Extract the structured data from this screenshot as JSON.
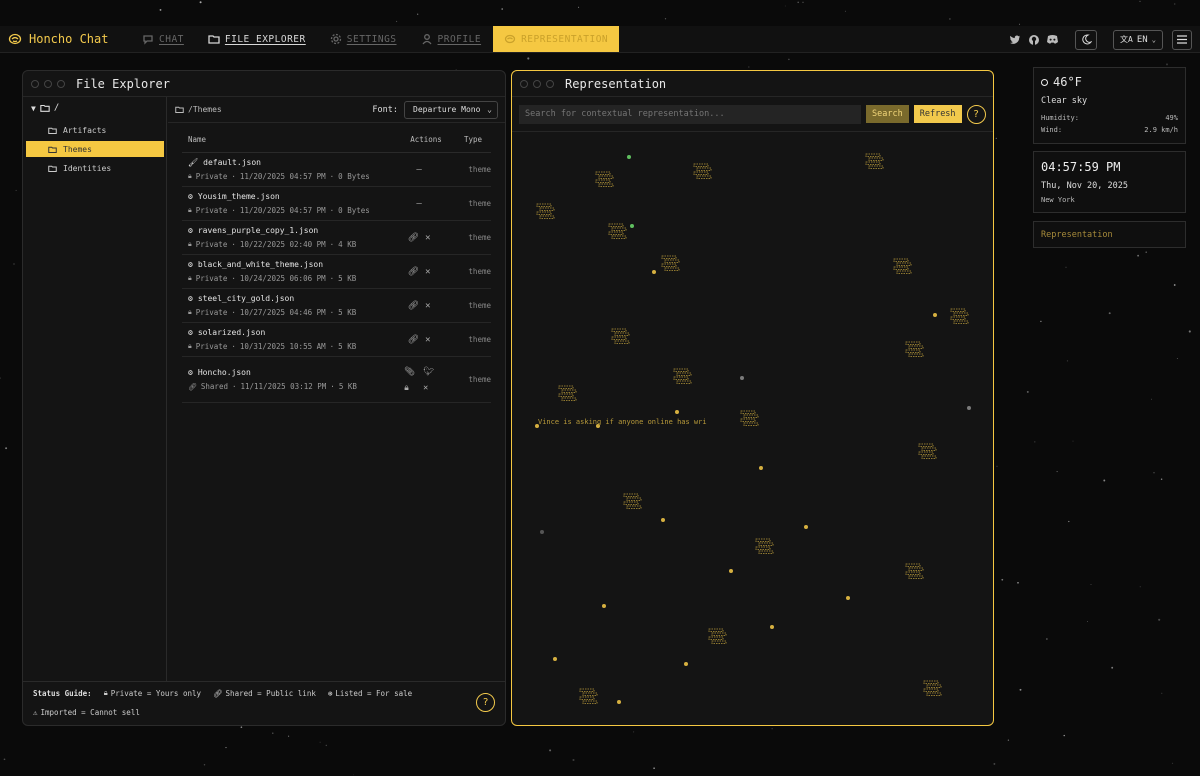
{
  "brand": {
    "name": "Honcho Chat"
  },
  "nav": [
    {
      "label": "CHAT",
      "icon": "chat-bubble-icon"
    },
    {
      "label": "FILE EXPLORER",
      "icon": "folder-icon"
    },
    {
      "label": "SETTINGS",
      "icon": "gear-icon"
    },
    {
      "label": "PROFILE",
      "icon": "user-icon"
    },
    {
      "label": "REPRESENTATION",
      "icon": "brain-icon"
    }
  ],
  "topbar": {
    "language": "EN",
    "accent": "#f5c842"
  },
  "file_explorer": {
    "title": "File Explorer",
    "tree_root": "/",
    "tree": [
      {
        "label": "Artifacts"
      },
      {
        "label": "Themes"
      },
      {
        "label": "Identities"
      }
    ],
    "path": "/Themes",
    "font_label": "Font:",
    "font_value": "Departure Mono",
    "columns": {
      "name": "Name",
      "actions": "Actions",
      "type": "Type"
    },
    "files": [
      {
        "name": "default.json",
        "visibility": "Private",
        "date": "11/20/2025 04:57 PM",
        "size": "0 Bytes",
        "type": "theme",
        "actions": "—"
      },
      {
        "name": "Yousim_theme.json",
        "visibility": "Private",
        "date": "11/20/2025 04:57 PM",
        "size": "0 Bytes",
        "type": "theme",
        "actions": "—"
      },
      {
        "name": "ravens_purple_copy_1.json",
        "visibility": "Private",
        "date": "10/22/2025 02:40 PM",
        "size": "4 KB",
        "type": "theme",
        "actions": "link"
      },
      {
        "name": "black_and_white_theme.json",
        "visibility": "Private",
        "date": "10/24/2025 06:06 PM",
        "size": "5 KB",
        "type": "theme",
        "actions": "link"
      },
      {
        "name": "steel_city_gold.json",
        "visibility": "Private",
        "date": "10/27/2025 04:46 PM",
        "size": "5 KB",
        "type": "theme",
        "actions": "link"
      },
      {
        "name": "solarized.json",
        "visibility": "Private",
        "date": "10/31/2025 10:55 AM",
        "size": "5 KB",
        "type": "theme",
        "actions": "link"
      },
      {
        "name": "Honcho.json",
        "visibility": "Shared",
        "date": "11/11/2025 03:12 PM",
        "size": "5 KB",
        "type": "theme",
        "actions": "shared"
      }
    ],
    "status_guide": {
      "label": "Status Guide:",
      "private": "Private = Yours only",
      "shared": "Shared = Public link",
      "listed": "Listed = For sale",
      "imported": "Imported = Cannot sell"
    }
  },
  "representation": {
    "title": "Representation",
    "search_placeholder": "Search for contextual representation...",
    "search_label": "Search",
    "refresh_label": "Refresh",
    "message": "Vince is asking if anyone online has wri"
  },
  "weather": {
    "temp": "46°F",
    "sky": "Clear sky",
    "humidity_label": "Humidity:",
    "humidity": "49%",
    "wind_label": "Wind:",
    "wind": "2.9 km/h"
  },
  "clock": {
    "time": "04:57:59 PM",
    "date": "Thu, Nov 20, 2025",
    "city": "New York"
  },
  "rep_tab": {
    "label": "Representation"
  }
}
